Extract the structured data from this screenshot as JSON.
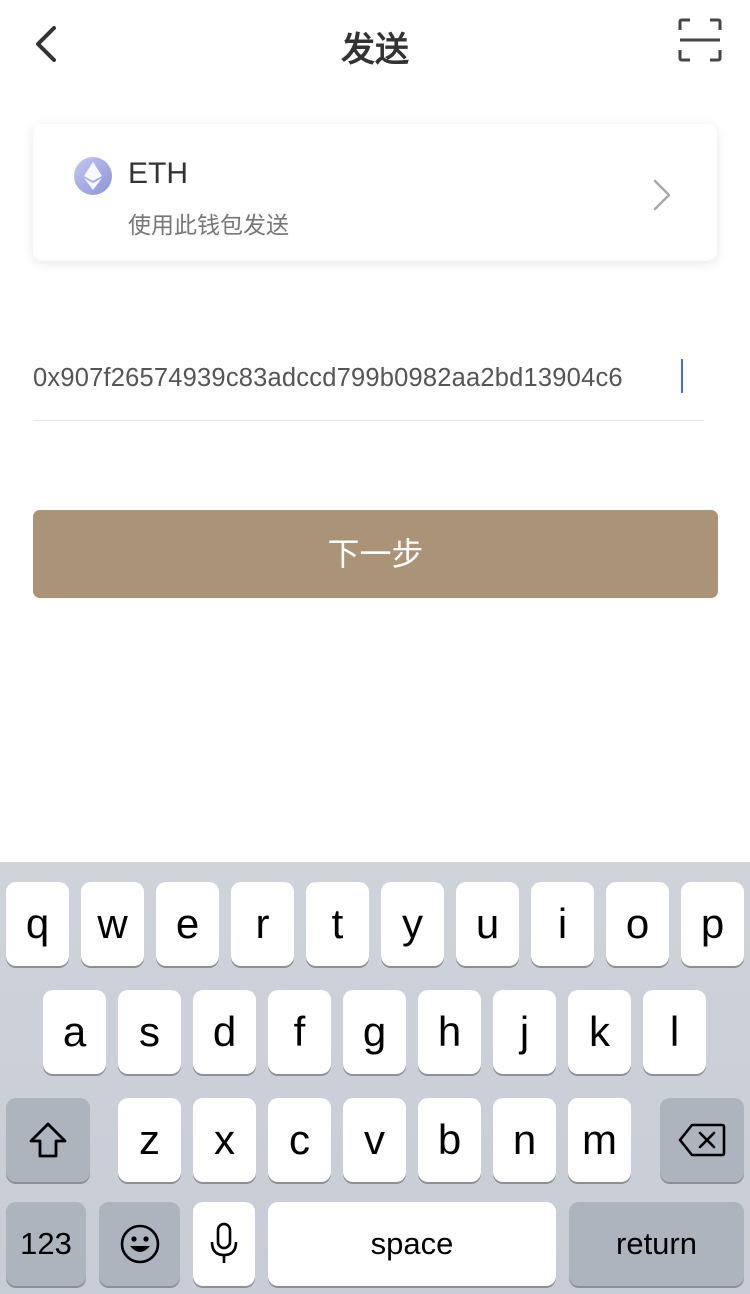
{
  "header": {
    "title": "发送"
  },
  "wallet": {
    "name": "ETH",
    "subtitle": "使用此钱包发送"
  },
  "address": {
    "value": "0x907f26574939c83adccd799b0982aa2bd13904c6"
  },
  "next_button": {
    "label": "下一步"
  },
  "keyboard": {
    "row1": [
      "q",
      "w",
      "e",
      "r",
      "t",
      "y",
      "u",
      "i",
      "o",
      "p"
    ],
    "row2": [
      "a",
      "s",
      "d",
      "f",
      "g",
      "h",
      "j",
      "k",
      "l"
    ],
    "row3": [
      "z",
      "x",
      "c",
      "v",
      "b",
      "n",
      "m"
    ],
    "numbers_label": "123",
    "space_label": "space",
    "return_label": "return"
  },
  "colors": {
    "accent": "#ab9377",
    "caret": "#4a6cf7"
  }
}
